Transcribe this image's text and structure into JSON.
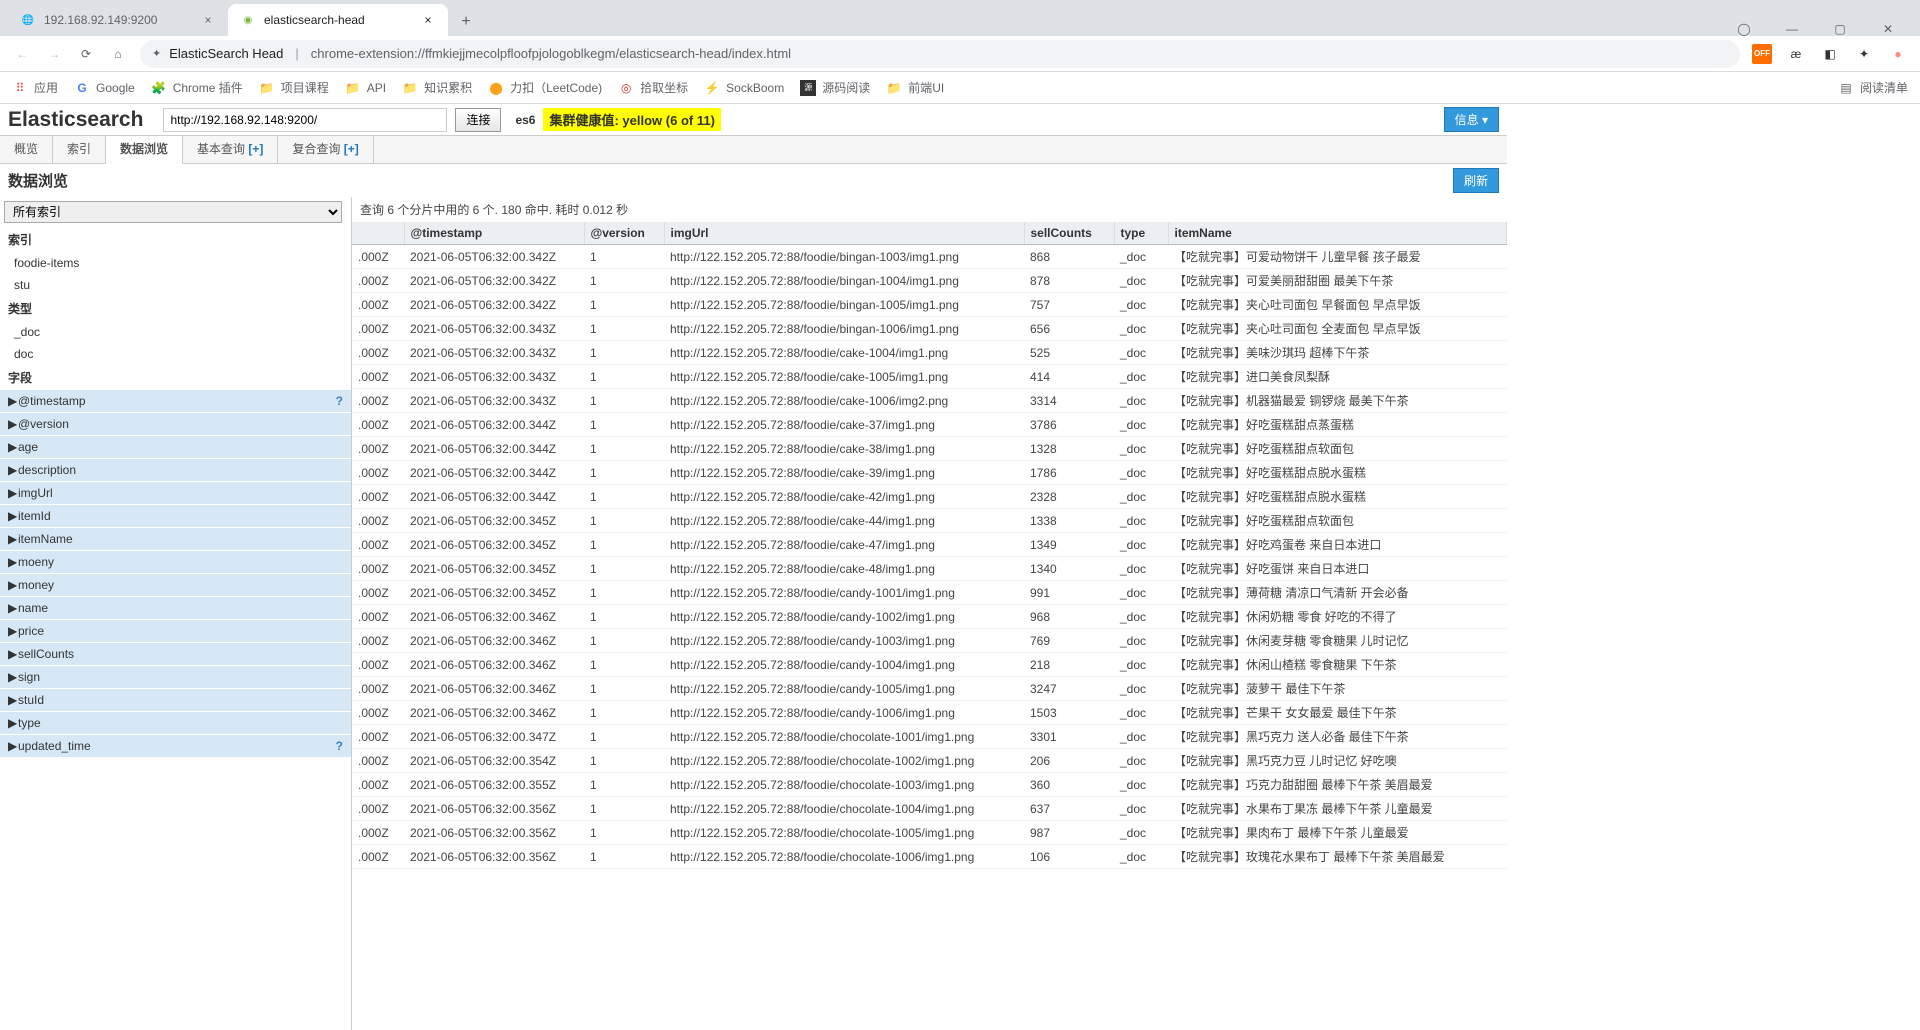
{
  "browser": {
    "tabs": [
      {
        "title": "192.168.92.149:9200",
        "active": false
      },
      {
        "title": "elasticsearch-head",
        "active": true
      }
    ],
    "url_prefix": "ElasticSearch Head",
    "url_path": "chrome-extension://ffmkiejjmecolpfloofpjologoblkegm/elasticsearch-head/index.html",
    "bookmarks": [
      {
        "label": "应用",
        "icon": "apps"
      },
      {
        "label": "Google",
        "icon": "G"
      },
      {
        "label": "Chrome 插件",
        "icon": "plug"
      },
      {
        "label": "项目课程",
        "icon": "folder"
      },
      {
        "label": "API",
        "icon": "folder"
      },
      {
        "label": "知识累积",
        "icon": "folder"
      },
      {
        "label": "力扣（LeetCode)",
        "icon": "leet"
      },
      {
        "label": "拾取坐标",
        "icon": "target"
      },
      {
        "label": "SockBoom",
        "icon": "bolt"
      },
      {
        "label": "源码阅读",
        "icon": "code"
      },
      {
        "label": "前端UI",
        "icon": "folder"
      }
    ],
    "readlist": "阅读清单",
    "ext_orange": "OFF"
  },
  "es": {
    "title": "Elasticsearch",
    "conn_url": "http://192.168.92.148:9200/",
    "connect_btn": "连接",
    "cluster_name": "es6",
    "health": "集群健康值: yellow (6 of 11)",
    "info_btn": "信息 ▾",
    "tabs": [
      {
        "label": "概览"
      },
      {
        "label": "索引"
      },
      {
        "label": "数据浏览",
        "active": true
      },
      {
        "label": "基本查询 [+]"
      },
      {
        "label": "复合查询 [+]"
      }
    ],
    "browser_title": "数据浏览",
    "refresh": "刷新"
  },
  "sidebar": {
    "select": "所有索引",
    "index_h": "索引",
    "indices": [
      "foodie-items",
      "stu"
    ],
    "type_h": "类型",
    "types": [
      "_doc",
      "doc"
    ],
    "field_h": "字段",
    "fields": [
      {
        "name": "@timestamp",
        "q": true
      },
      {
        "name": "@version"
      },
      {
        "name": "age"
      },
      {
        "name": "description"
      },
      {
        "name": "imgUrl"
      },
      {
        "name": "itemId"
      },
      {
        "name": "itemName"
      },
      {
        "name": "moeny"
      },
      {
        "name": "money"
      },
      {
        "name": "name"
      },
      {
        "name": "price"
      },
      {
        "name": "sellCounts"
      },
      {
        "name": "sign"
      },
      {
        "name": "stuId"
      },
      {
        "name": "type"
      },
      {
        "name": "updated_time",
        "q": true
      }
    ]
  },
  "results": {
    "info": "查询 6 个分片中用的 6 个. 180 命中. 耗时 0.012 秒",
    "columns": [
      "",
      "@timestamp",
      "@version",
      "imgUrl",
      "sellCounts",
      "type",
      "itemName"
    ],
    "rows": [
      {
        "ts": ".000Z",
        "time": "2021-06-05T06:32:00.342Z",
        "v": "1",
        "img": "http://122.152.205.72:88/foodie/bingan-1003/img1.png",
        "sell": "868",
        "type": "_doc",
        "name": "【吃就完事】可爱动物饼干 儿童早餐 孩子最爱"
      },
      {
        "ts": ".000Z",
        "time": "2021-06-05T06:32:00.342Z",
        "v": "1",
        "img": "http://122.152.205.72:88/foodie/bingan-1004/img1.png",
        "sell": "878",
        "type": "_doc",
        "name": "【吃就完事】可爱美丽甜甜圈 最美下午茶"
      },
      {
        "ts": ".000Z",
        "time": "2021-06-05T06:32:00.342Z",
        "v": "1",
        "img": "http://122.152.205.72:88/foodie/bingan-1005/img1.png",
        "sell": "757",
        "type": "_doc",
        "name": "【吃就完事】夹心吐司面包 早餐面包 早点早饭"
      },
      {
        "ts": ".000Z",
        "time": "2021-06-05T06:32:00.343Z",
        "v": "1",
        "img": "http://122.152.205.72:88/foodie/bingan-1006/img1.png",
        "sell": "656",
        "type": "_doc",
        "name": "【吃就完事】夹心吐司面包 全麦面包 早点早饭"
      },
      {
        "ts": ".000Z",
        "time": "2021-06-05T06:32:00.343Z",
        "v": "1",
        "img": "http://122.152.205.72:88/foodie/cake-1004/img1.png",
        "sell": "525",
        "type": "_doc",
        "name": "【吃就完事】美味沙琪玛 超棒下午茶"
      },
      {
        "ts": ".000Z",
        "time": "2021-06-05T06:32:00.343Z",
        "v": "1",
        "img": "http://122.152.205.72:88/foodie/cake-1005/img1.png",
        "sell": "414",
        "type": "_doc",
        "name": "【吃就完事】进口美食凤梨酥"
      },
      {
        "ts": ".000Z",
        "time": "2021-06-05T06:32:00.343Z",
        "v": "1",
        "img": "http://122.152.205.72:88/foodie/cake-1006/img2.png",
        "sell": "3314",
        "type": "_doc",
        "name": "【吃就完事】机器猫最爱 铜锣烧 最美下午茶"
      },
      {
        "ts": ".000Z",
        "time": "2021-06-05T06:32:00.344Z",
        "v": "1",
        "img": "http://122.152.205.72:88/foodie/cake-37/img1.png",
        "sell": "3786",
        "type": "_doc",
        "name": "【吃就完事】好吃蛋糕甜点蒸蛋糕"
      },
      {
        "ts": ".000Z",
        "time": "2021-06-05T06:32:00.344Z",
        "v": "1",
        "img": "http://122.152.205.72:88/foodie/cake-38/img1.png",
        "sell": "1328",
        "type": "_doc",
        "name": "【吃就完事】好吃蛋糕甜点软面包"
      },
      {
        "ts": ".000Z",
        "time": "2021-06-05T06:32:00.344Z",
        "v": "1",
        "img": "http://122.152.205.72:88/foodie/cake-39/img1.png",
        "sell": "1786",
        "type": "_doc",
        "name": "【吃就完事】好吃蛋糕甜点脱水蛋糕"
      },
      {
        "ts": ".000Z",
        "time": "2021-06-05T06:32:00.344Z",
        "v": "1",
        "img": "http://122.152.205.72:88/foodie/cake-42/img1.png",
        "sell": "2328",
        "type": "_doc",
        "name": "【吃就完事】好吃蛋糕甜点脱水蛋糕"
      },
      {
        "ts": ".000Z",
        "time": "2021-06-05T06:32:00.345Z",
        "v": "1",
        "img": "http://122.152.205.72:88/foodie/cake-44/img1.png",
        "sell": "1338",
        "type": "_doc",
        "name": "【吃就完事】好吃蛋糕甜点软面包"
      },
      {
        "ts": ".000Z",
        "time": "2021-06-05T06:32:00.345Z",
        "v": "1",
        "img": "http://122.152.205.72:88/foodie/cake-47/img1.png",
        "sell": "1349",
        "type": "_doc",
        "name": "【吃就完事】好吃鸡蛋卷 来自日本进口"
      },
      {
        "ts": ".000Z",
        "time": "2021-06-05T06:32:00.345Z",
        "v": "1",
        "img": "http://122.152.205.72:88/foodie/cake-48/img1.png",
        "sell": "1340",
        "type": "_doc",
        "name": "【吃就完事】好吃蛋饼 来自日本进口"
      },
      {
        "ts": ".000Z",
        "time": "2021-06-05T06:32:00.345Z",
        "v": "1",
        "img": "http://122.152.205.72:88/foodie/candy-1001/img1.png",
        "sell": "991",
        "type": "_doc",
        "name": "【吃就完事】薄荷糖 清凉口气清新 开会必备"
      },
      {
        "ts": ".000Z",
        "time": "2021-06-05T06:32:00.346Z",
        "v": "1",
        "img": "http://122.152.205.72:88/foodie/candy-1002/img1.png",
        "sell": "968",
        "type": "_doc",
        "name": "【吃就完事】休闲奶糖 零食 好吃的不得了"
      },
      {
        "ts": ".000Z",
        "time": "2021-06-05T06:32:00.346Z",
        "v": "1",
        "img": "http://122.152.205.72:88/foodie/candy-1003/img1.png",
        "sell": "769",
        "type": "_doc",
        "name": "【吃就完事】休闲麦芽糖 零食糖果 儿时记忆"
      },
      {
        "ts": ".000Z",
        "time": "2021-06-05T06:32:00.346Z",
        "v": "1",
        "img": "http://122.152.205.72:88/foodie/candy-1004/img1.png",
        "sell": "218",
        "type": "_doc",
        "name": "【吃就完事】休闲山楂糕 零食糖果 下午茶"
      },
      {
        "ts": ".000Z",
        "time": "2021-06-05T06:32:00.346Z",
        "v": "1",
        "img": "http://122.152.205.72:88/foodie/candy-1005/img1.png",
        "sell": "3247",
        "type": "_doc",
        "name": "【吃就完事】菠萝干 最佳下午茶"
      },
      {
        "ts": ".000Z",
        "time": "2021-06-05T06:32:00.346Z",
        "v": "1",
        "img": "http://122.152.205.72:88/foodie/candy-1006/img1.png",
        "sell": "1503",
        "type": "_doc",
        "name": "【吃就完事】芒果干 女女最爱 最佳下午茶"
      },
      {
        "ts": ".000Z",
        "time": "2021-06-05T06:32:00.347Z",
        "v": "1",
        "img": "http://122.152.205.72:88/foodie/chocolate-1001/img1.png",
        "sell": "3301",
        "type": "_doc",
        "name": "【吃就完事】黑巧克力 送人必备 最佳下午茶"
      },
      {
        "ts": ".000Z",
        "time": "2021-06-05T06:32:00.354Z",
        "v": "1",
        "img": "http://122.152.205.72:88/foodie/chocolate-1002/img1.png",
        "sell": "206",
        "type": "_doc",
        "name": "【吃就完事】黑巧克力豆 儿时记忆 好吃噢"
      },
      {
        "ts": ".000Z",
        "time": "2021-06-05T06:32:00.355Z",
        "v": "1",
        "img": "http://122.152.205.72:88/foodie/chocolate-1003/img1.png",
        "sell": "360",
        "type": "_doc",
        "name": "【吃就完事】巧克力甜甜圈 最棒下午茶 美眉最爱"
      },
      {
        "ts": ".000Z",
        "time": "2021-06-05T06:32:00.356Z",
        "v": "1",
        "img": "http://122.152.205.72:88/foodie/chocolate-1004/img1.png",
        "sell": "637",
        "type": "_doc",
        "name": "【吃就完事】水果布丁果冻 最棒下午茶 儿童最爱"
      },
      {
        "ts": ".000Z",
        "time": "2021-06-05T06:32:00.356Z",
        "v": "1",
        "img": "http://122.152.205.72:88/foodie/chocolate-1005/img1.png",
        "sell": "987",
        "type": "_doc",
        "name": "【吃就完事】果肉布丁 最棒下午茶 儿童最爱"
      },
      {
        "ts": ".000Z",
        "time": "2021-06-05T06:32:00.356Z",
        "v": "1",
        "img": "http://122.152.205.72:88/foodie/chocolate-1006/img1.png",
        "sell": "106",
        "type": "_doc",
        "name": "【吃就完事】玫瑰花水果布丁 最棒下午茶 美眉最爱"
      }
    ]
  }
}
